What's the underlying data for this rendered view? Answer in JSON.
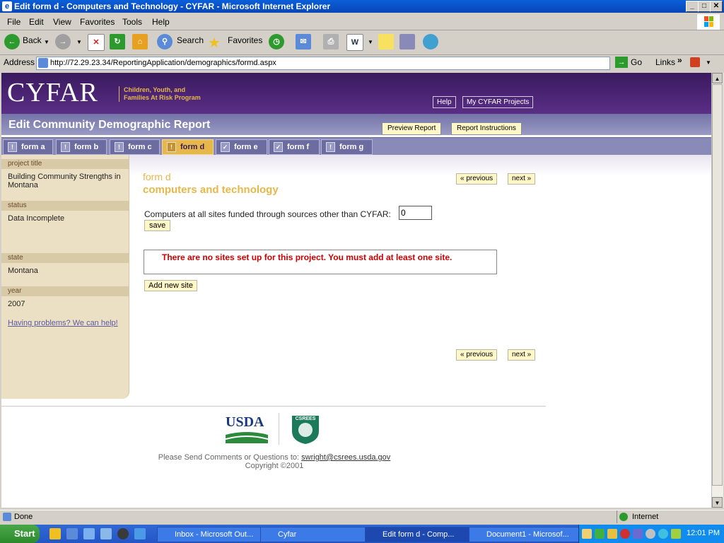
{
  "window": {
    "title": "Edit form d - Computers and Technology - CYFAR - Microsoft Internet Explorer",
    "controls": {
      "minimize": "_",
      "maximize": "□",
      "close": "✕"
    }
  },
  "menubar": [
    "File",
    "Edit",
    "View",
    "Favorites",
    "Tools",
    "Help"
  ],
  "toolbar": {
    "back": "Back",
    "search": "Search",
    "favorites": "Favorites"
  },
  "address": {
    "label": "Address",
    "url": "http://72.29.23.34/ReportingApplication/demographics/formd.aspx",
    "go": "Go",
    "links": "Links"
  },
  "site": {
    "logo": "CYFAR",
    "tagline_1": "Children, Youth, and",
    "tagline_2": "Families At Risk Program",
    "help": "Help",
    "my_projects": "My CYFAR Projects",
    "page_title": "Edit Community Demographic Report",
    "preview_report": "Preview Report",
    "report_instructions": "Report Instructions"
  },
  "tabs": [
    {
      "label": "form a",
      "icon": "!"
    },
    {
      "label": "form b",
      "icon": "!"
    },
    {
      "label": "form c",
      "icon": "!"
    },
    {
      "label": "form d",
      "icon": "!"
    },
    {
      "label": "form e",
      "icon": "✓"
    },
    {
      "label": "form f",
      "icon": "✓"
    },
    {
      "label": "form g",
      "icon": "!"
    }
  ],
  "sidebar": {
    "project_title_label": "project title",
    "project_title": "Building Community Strengths in Montana",
    "status_label": "status",
    "status": "Data Incomplete",
    "state_label": "state",
    "state": "Montana",
    "year_label": "year",
    "year": "2007",
    "help_link": "Having problems? We can help!"
  },
  "form": {
    "name": "form d",
    "subtitle": "computers and technology",
    "previous": "« previous",
    "next": "next »",
    "computers_label": "Computers at all sites funded through sources other than CYFAR:",
    "computers_value": "0",
    "save": "save",
    "warning": "There are no sites set up for this project. You must add at least one site.",
    "add_site": "Add new site"
  },
  "footer": {
    "usda": "USDA",
    "csrees": "CSREES",
    "contact_prefix": "Please Send Comments or Questions to:",
    "contact_email": "swright@csrees.usda.gov",
    "copyright": "Copyright ©2001"
  },
  "statusbar": {
    "status": "Done",
    "zone": "Internet"
  },
  "taskbar": {
    "start": "Start",
    "tasks": [
      "Inbox - Microsoft Out...",
      "Cyfar",
      "Edit form d - Comp...",
      "Document1 - Microsof..."
    ],
    "clock": "12:01 PM"
  }
}
